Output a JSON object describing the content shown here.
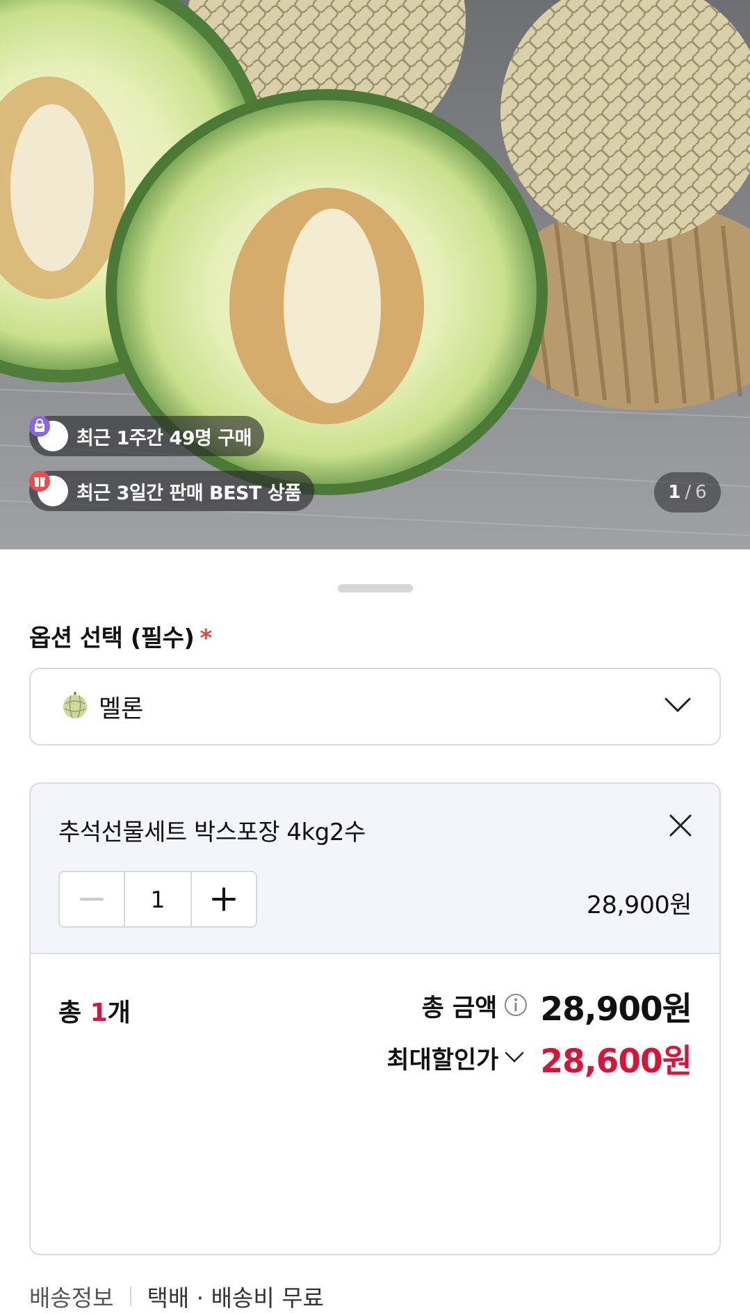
{
  "hero": {
    "badges": [
      {
        "icon": "shopping-bag-icon",
        "text": "최근 1주간 49명 구매"
      },
      {
        "icon": "gift-box-icon",
        "text": "최근 3일간 판매 BEST 상품"
      }
    ],
    "counter": {
      "current": "1",
      "separator": "/",
      "total": "6"
    }
  },
  "option": {
    "title": "옵션 선택 (필수)",
    "required_mark": "*",
    "select": {
      "icon": "melon-icon",
      "value": "멜론"
    }
  },
  "selected_item": {
    "name": "추석선물세트 박스포장 4kg2수",
    "quantity": "1",
    "price": "28,900원"
  },
  "summary": {
    "count_prefix": "총 ",
    "count": "1",
    "count_suffix": "개",
    "total_label": "총 금액",
    "total_value": "28,900원",
    "discount_label": "최대할인가",
    "discount_value": "28,600원"
  },
  "delivery": {
    "label": "배송정보",
    "value": "택배 · 배송비 무료"
  },
  "colors": {
    "accent_red": "#d7143a",
    "required_red": "#e8453c",
    "item_bg": "#f3f5fb"
  }
}
